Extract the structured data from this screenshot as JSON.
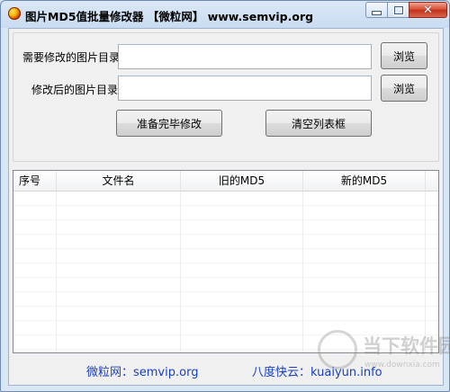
{
  "window": {
    "title": "图片MD5值批量修改器 【微粒网】 www.semvip.org",
    "minimize_glyph": "",
    "close_glyph": "✕"
  },
  "form": {
    "source_dir_label": "需要修改的图片目录",
    "source_dir_value": "",
    "output_dir_label": "修改后的图片目录",
    "output_dir_value": "",
    "browse_label": "浏览",
    "start_button": "准备完毕修改",
    "clear_button": "清空列表框"
  },
  "table": {
    "columns": [
      "序号",
      "文件名",
      "旧的MD5",
      "新的MD5",
      ""
    ],
    "rows": []
  },
  "footer": {
    "left_link": "微粒网：semvip.org",
    "right_link": "八度快云：kuaiyun.info"
  },
  "watermark": {
    "text": "当下软件园",
    "sub": "www.downxia.com"
  },
  "colors": {
    "link": "#1a3fbf",
    "close_button": "#c9391f"
  }
}
